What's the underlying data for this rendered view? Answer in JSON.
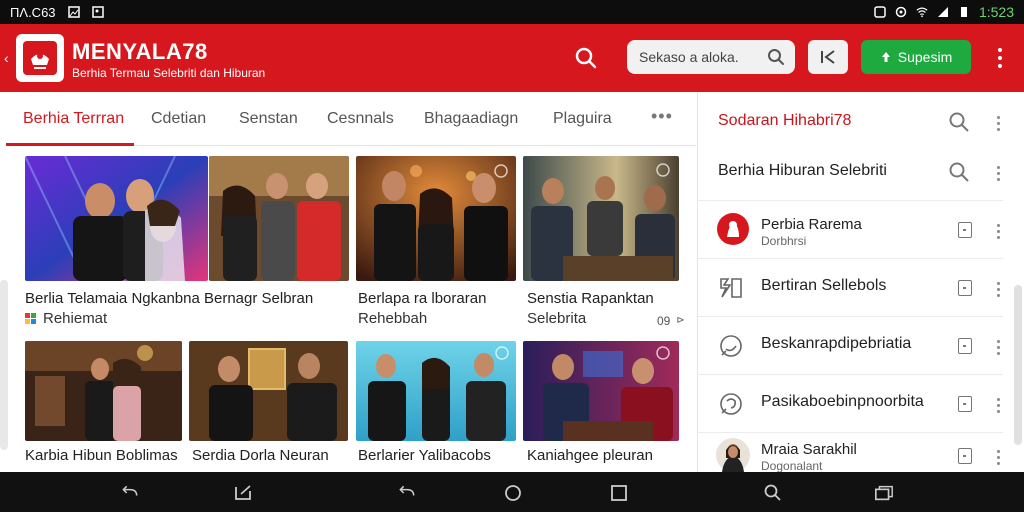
{
  "status_bar": {
    "left_text": "ΠΛ.C63",
    "time": "1:523"
  },
  "app": {
    "title": "MENYALA78",
    "subtitle": "Berhia Termau Selebriti dan Hiburan",
    "search_placeholder": "Sekaso a aloka.",
    "subscribe_label": "Supesim",
    "accent_color": "#d6171d",
    "subscribe_color": "#1eaa3e"
  },
  "tabs": [
    {
      "label": "Berhia Terrran",
      "active": true
    },
    {
      "label": "Cdetian"
    },
    {
      "label": "Senstan"
    },
    {
      "label": "Cesnnals"
    },
    {
      "label": "Bhagaadiagn"
    },
    {
      "label": "Plaguira"
    }
  ],
  "videos": [
    {
      "title": "Berlia Telamaia Ngkanbna Bernagr Selbran",
      "meta": "Rehiemat",
      "meta_icon": "palette-icon"
    },
    {
      "title": "Berlapa ra lboraran",
      "meta": "Rehebbah"
    },
    {
      "title": "Senstia Rapanktan",
      "meta": "Selebrita",
      "meta_right": "09"
    },
    {
      "title": "Karbia Hibun Boblimas"
    },
    {
      "title": "Serdia Dorla Neuran"
    },
    {
      "title": "Berlarier Yalibacobs"
    },
    {
      "title": "Kaniahgee pleuran"
    }
  ],
  "side_panel": {
    "header": "Sodaran Hihabri78",
    "search_label": "Berhia Hiburan Selebriti",
    "items": [
      {
        "label": "Perbia Rarema",
        "sub": "Dorbhrsi",
        "icon": "avatar-red-icon"
      },
      {
        "label": "Bertiran Sellebols",
        "icon": "brand-icon"
      },
      {
        "label": "Beskanrapdipebriatia",
        "icon": "chat-icon"
      },
      {
        "label": "Pasikaboebinpnoorbita",
        "icon": "chat-icon"
      },
      {
        "label": "Mraia Sarakhil",
        "sub": "Dogonalant",
        "icon": "avatar-photo-icon"
      }
    ]
  }
}
